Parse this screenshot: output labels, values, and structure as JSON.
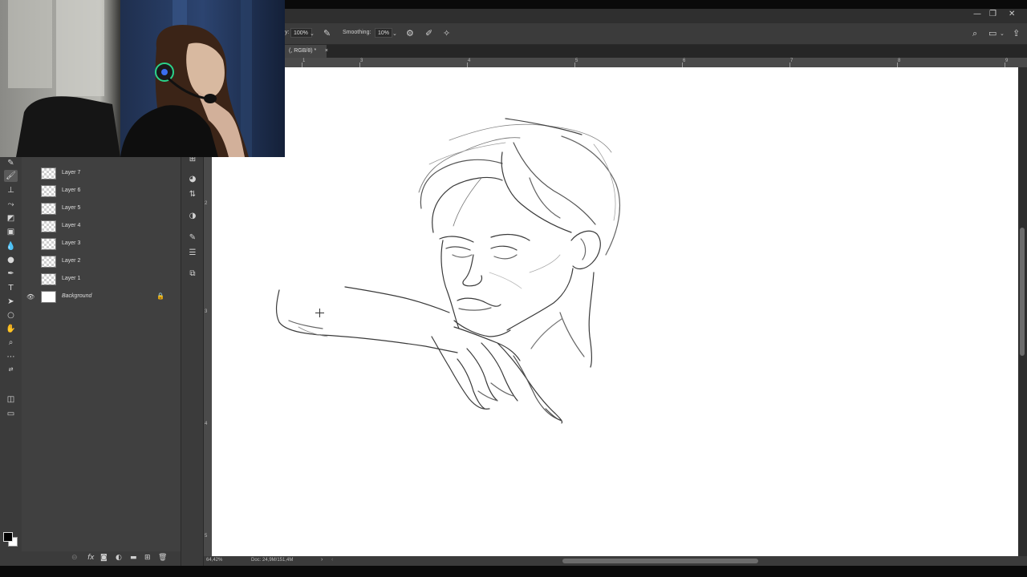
{
  "window": {
    "controls": [
      "—",
      "❐",
      "✕"
    ]
  },
  "options_bar": {
    "opacity_value": "100%",
    "smoothing_label": "Smoothing:",
    "smoothing_value": "10%"
  },
  "document_tab": {
    "label": "(, RGB/8) *",
    "close": "×"
  },
  "ruler": {
    "numbers": [
      "1",
      "3",
      "4",
      "5",
      "6",
      "7",
      "8",
      "9"
    ]
  },
  "vruler": {
    "numbers": [
      "2",
      "3",
      "4",
      "5"
    ]
  },
  "layers": [
    {
      "name": "Layer 7",
      "visible": false
    },
    {
      "name": "Layer 6",
      "visible": false
    },
    {
      "name": "Layer 5",
      "visible": false
    },
    {
      "name": "Layer 4",
      "visible": false
    },
    {
      "name": "Layer 3",
      "visible": false
    },
    {
      "name": "Layer 2",
      "visible": false
    },
    {
      "name": "Layer 1",
      "visible": false
    },
    {
      "name": "Background",
      "visible": true,
      "locked": true
    }
  ],
  "status": {
    "zoom": "64,42%",
    "doc_size": "Doc: 24,9M/151,4M"
  },
  "colors": {
    "foreground": "#000000",
    "background": "#ffffff"
  },
  "icons": {
    "toolbar": [
      "brush-icon",
      "brush-icon",
      "stamp-icon",
      "history-brush-icon",
      "eraser-icon",
      "gradient-icon",
      "blur-icon",
      "dodge-icon",
      "pen-icon",
      "type-icon",
      "path-select-icon",
      "ellipse-icon",
      "hand-icon",
      "zoom-icon",
      "more-icon"
    ],
    "side": [
      "grid-icon",
      "color-icon",
      "adjust-icon",
      "brush-settings-icon",
      "properties-icon",
      "channels-icon"
    ]
  }
}
